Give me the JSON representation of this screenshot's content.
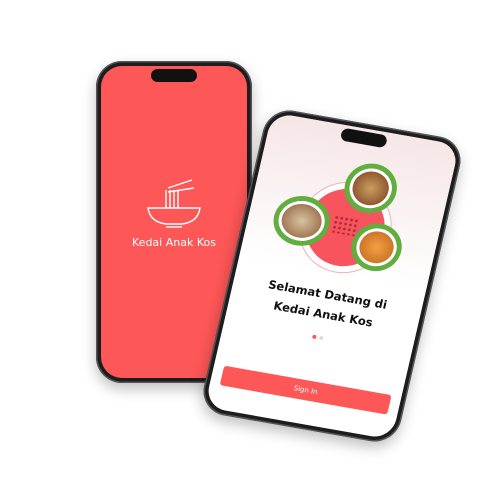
{
  "splash": {
    "app_name": "Kedai Anak Kos",
    "icon": "noodle-bowl-icon"
  },
  "onboarding": {
    "title_line1": "Selamat Datang di",
    "title_line2": "Kedai Anak Kos",
    "page_count": 2,
    "active_page": 1,
    "sign_in_label": "Sign In"
  },
  "colors": {
    "brand": "#fe5757",
    "phone_frame": "#1d1d1f"
  }
}
